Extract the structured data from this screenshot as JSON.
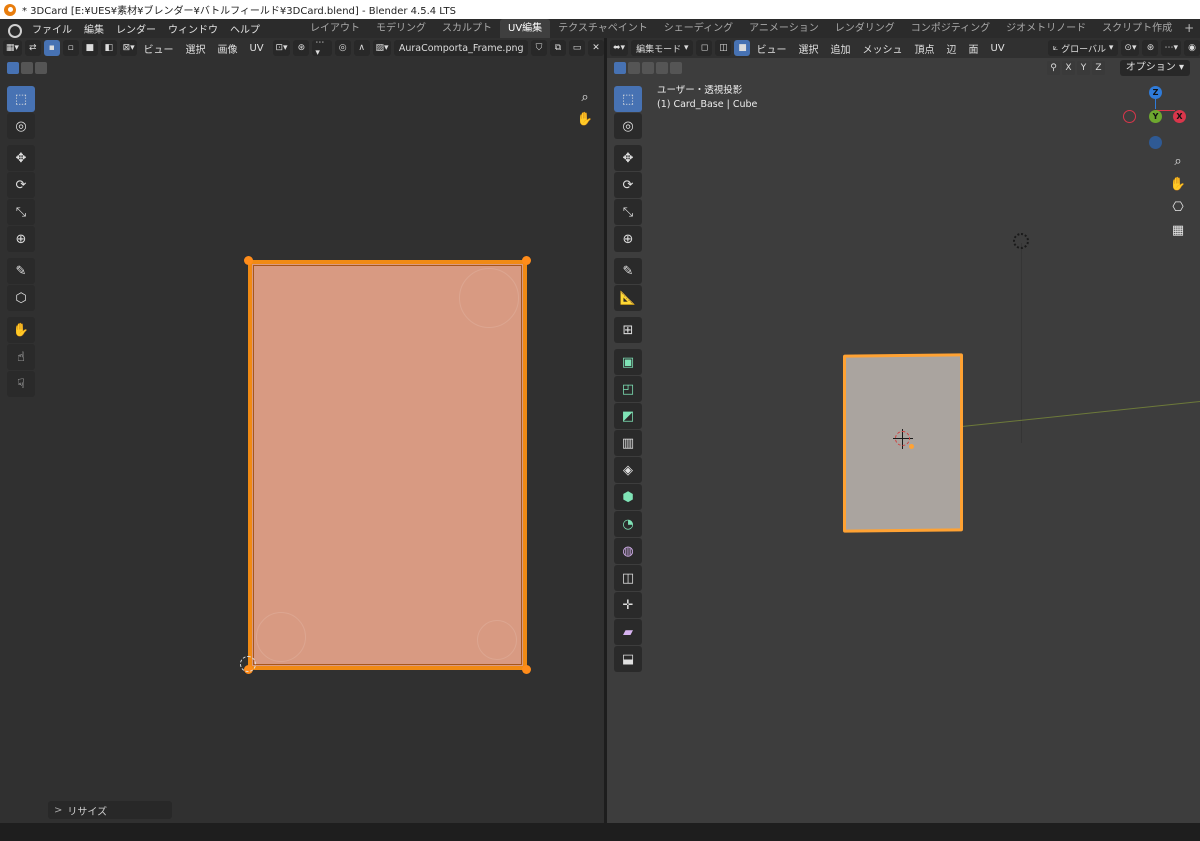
{
  "window": {
    "title": "* 3DCard [E:¥UES¥素材¥ブレンダー¥バトルフィールド¥3DCard.blend] - Blender 4.5.4 LTS"
  },
  "menubar": {
    "items": [
      "ファイル",
      "編集",
      "レンダー",
      "ウィンドウ",
      "ヘルプ"
    ]
  },
  "workspaces": {
    "tabs": [
      "レイアウト",
      "モデリング",
      "スカルプト",
      "UV編集",
      "テクスチャペイント",
      "シェーディング",
      "アニメーション",
      "レンダリング",
      "コンポジティング",
      "ジオメトリノード",
      "スクリプト作成"
    ],
    "active": "UV編集",
    "add": "+"
  },
  "uv_editor": {
    "menus": [
      "ビュー",
      "選択",
      "画像",
      "UV"
    ],
    "image_name": "AuraComporta_Frame.png",
    "panel_label": "リサイズ",
    "panel_arrow": ">",
    "tools": [
      "select-box-icon",
      "cursor-icon",
      "move-icon",
      "rotate-icon",
      "scale-icon",
      "transform-icon",
      "annotate-icon",
      "scale-cage-icon",
      "grab-icon",
      "relax-icon",
      "pinch-icon"
    ],
    "selected_tool": "select-box-icon"
  },
  "viewport": {
    "mode": "編集モード",
    "menus": [
      "ビュー",
      "選択",
      "追加",
      "メッシュ",
      "頂点",
      "辺",
      "面",
      "UV"
    ],
    "orientation": "グローバル",
    "options_label": "オプション",
    "axis_toggles": [
      "X",
      "Y",
      "Z"
    ],
    "overlay_line1": "ユーザー・透視投影",
    "overlay_line2": "(1) Card_Base | Cube",
    "gizmo": {
      "x": "X",
      "y": "Y",
      "z": "Z",
      "x_color": "#d9364b",
      "y_color": "#6ea82f",
      "z_color": "#2f7bd9"
    },
    "tools": [
      "select-box-icon",
      "cursor-icon",
      "move-icon",
      "rotate-icon",
      "scale-icon",
      "transform-icon",
      "annotate-icon",
      "measure-icon",
      "add-cube-icon",
      "extrude-icon",
      "inset-icon",
      "bevel-icon",
      "loop-cut-icon",
      "knife-icon",
      "poly-build-icon",
      "spin-icon",
      "smooth-icon",
      "edge-slide-icon",
      "shrink-fatten-icon",
      "shear-icon",
      "rip-icon"
    ],
    "selected_tool": "select-box-icon"
  },
  "colors": {
    "selection_orange": "#f08a14",
    "active_blue": "#4772b3",
    "texture_fill": "#d89a82"
  }
}
